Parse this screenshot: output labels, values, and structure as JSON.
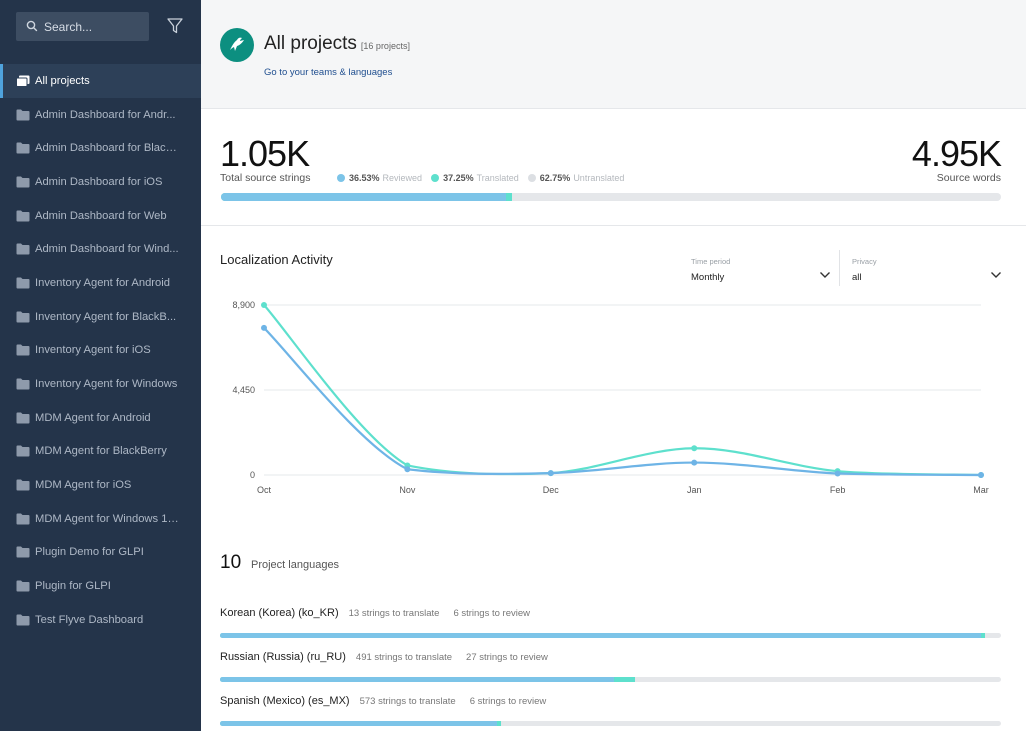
{
  "sidebar": {
    "search_placeholder": "Search...",
    "items": [
      {
        "label": "All projects",
        "active": true
      },
      {
        "label": "Admin Dashboard for Andr..."
      },
      {
        "label": "Admin Dashboard for Black..."
      },
      {
        "label": "Admin Dashboard for iOS"
      },
      {
        "label": "Admin Dashboard for Web"
      },
      {
        "label": "Admin Dashboard for Wind..."
      },
      {
        "label": "Inventory Agent for Android"
      },
      {
        "label": "Inventory Agent for BlackB..."
      },
      {
        "label": "Inventory Agent for iOS"
      },
      {
        "label": "Inventory Agent for Windows"
      },
      {
        "label": "MDM Agent for Android"
      },
      {
        "label": "MDM Agent for BlackBerry"
      },
      {
        "label": "MDM Agent for iOS"
      },
      {
        "label": "MDM Agent for Windows 10..."
      },
      {
        "label": "Plugin Demo for GLPI"
      },
      {
        "label": "Plugin for GLPI"
      },
      {
        "label": "Test Flyve Dashboard"
      }
    ]
  },
  "header": {
    "title": "All projects",
    "project_count": "[16 projects]",
    "teams_link": "Go to your teams & languages"
  },
  "stats": {
    "source_strings": "1.05K",
    "source_strings_label": "Total source strings",
    "source_words": "4.95K",
    "source_words_label": "Source words",
    "reviewed_pct": "36.53%",
    "reviewed_label": "Reviewed",
    "translated_pct": "37.25%",
    "translated_label": "Translated",
    "untranslated_pct": "62.75%",
    "untranslated_label": "Untranslated",
    "progress_reviewed": 0.3653,
    "progress_translated": 0.3725
  },
  "colors": {
    "reviewed": "#7cc4e8",
    "translated": "#5ee0cd",
    "untranslated": "#dcdfe3",
    "sidebar_bg": "#24344a"
  },
  "activity": {
    "title": "Localization Activity",
    "time_period_caption": "Time period",
    "time_period_value": "Monthly",
    "privacy_caption": "Privacy",
    "privacy_value": "all"
  },
  "chart_data": {
    "type": "line",
    "categories": [
      "Oct",
      "Nov",
      "Dec",
      "Jan",
      "Feb",
      "Mar"
    ],
    "y_ticks": [
      "0",
      "4,450",
      "8,900"
    ],
    "ylim": [
      0,
      8900
    ],
    "grid": true,
    "series": [
      {
        "color": "#5ee0cd",
        "values": [
          8900,
          500,
          100,
          1400,
          200,
          0
        ]
      },
      {
        "color": "#6eb4e6",
        "values": [
          7700,
          300,
          100,
          650,
          80,
          0
        ]
      }
    ]
  },
  "languages": {
    "count": "10",
    "label": "Project languages",
    "items": [
      {
        "name": "Korean (Korea) (ko_KR)",
        "to_translate": "13 strings to translate",
        "to_review": "6 strings to review",
        "reviewed": 0.975,
        "translated": 0.98
      },
      {
        "name": "Russian (Russia) (ru_RU)",
        "to_translate": "491 strings to translate",
        "to_review": "27 strings to review",
        "reviewed": 0.505,
        "translated": 0.532
      },
      {
        "name": "Spanish (Mexico) (es_MX)",
        "to_translate": "573 strings to translate",
        "to_review": "6 strings to review",
        "reviewed": 0.355,
        "translated": 0.36
      }
    ]
  }
}
